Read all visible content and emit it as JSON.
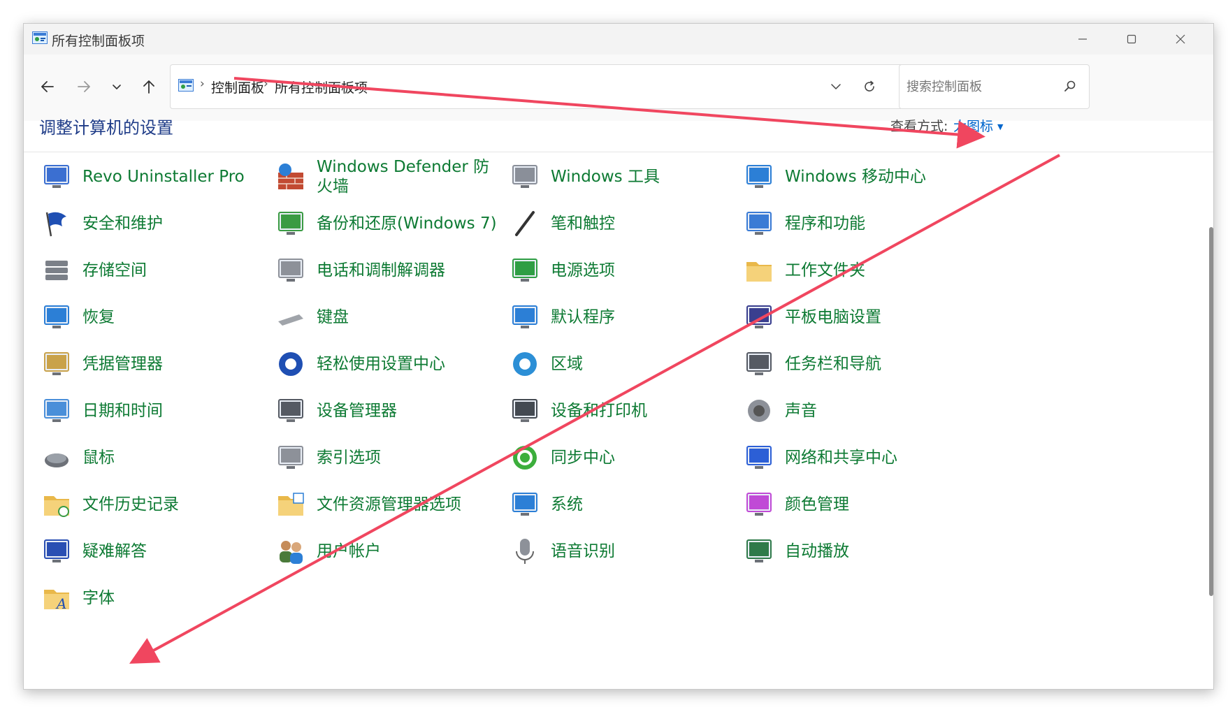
{
  "window": {
    "title": "所有控制面板项",
    "accent_color": "#1f3c88",
    "link_color": "#0d7a33",
    "controls": {
      "minimize": "minimize-icon",
      "maximize": "maximize-icon",
      "close": "close-icon"
    }
  },
  "nav": {
    "back": "back-arrow-icon",
    "forward": "forward-arrow-icon",
    "recent": "chevron-down-icon",
    "up": "up-arrow-icon"
  },
  "address": {
    "crumbs": [
      "控制面板",
      "所有控制面板项"
    ],
    "separator": "›",
    "dropdown": "chevron-down-icon",
    "refresh": "refresh-icon"
  },
  "search": {
    "placeholder": "搜索控制面板",
    "value": ""
  },
  "header": {
    "title": "调整计算机的设置",
    "view_label": "查看方式:",
    "view_value": "大图标"
  },
  "annotation_arrow_color": "#f0465f",
  "items": [
    {
      "label": "Revo Uninstaller Pro",
      "icon": "revo-uninstaller-icon"
    },
    {
      "label": "Windows Defender 防火墙",
      "icon": "firewall-icon"
    },
    {
      "label": "Windows 工具",
      "icon": "windows-tools-icon"
    },
    {
      "label": "Windows 移动中心",
      "icon": "mobility-center-icon"
    },
    {
      "label": "安全和维护",
      "icon": "security-flag-icon"
    },
    {
      "label": "备份和还原(Windows 7)",
      "icon": "backup-restore-icon"
    },
    {
      "label": "笔和触控",
      "icon": "pen-icon"
    },
    {
      "label": "程序和功能",
      "icon": "programs-icon"
    },
    {
      "label": "存储空间",
      "icon": "storage-icon"
    },
    {
      "label": "电话和调制解调器",
      "icon": "phone-modem-icon"
    },
    {
      "label": "电源选项",
      "icon": "power-options-icon"
    },
    {
      "label": "工作文件夹",
      "icon": "work-folders-icon"
    },
    {
      "label": "恢复",
      "icon": "recovery-icon"
    },
    {
      "label": "键盘",
      "icon": "keyboard-icon"
    },
    {
      "label": "默认程序",
      "icon": "default-programs-icon"
    },
    {
      "label": "平板电脑设置",
      "icon": "tablet-settings-icon"
    },
    {
      "label": "凭据管理器",
      "icon": "credential-manager-icon"
    },
    {
      "label": "轻松使用设置中心",
      "icon": "ease-of-access-icon"
    },
    {
      "label": "区域",
      "icon": "region-icon"
    },
    {
      "label": "任务栏和导航",
      "icon": "taskbar-icon"
    },
    {
      "label": "日期和时间",
      "icon": "date-time-icon"
    },
    {
      "label": "设备管理器",
      "icon": "device-manager-icon"
    },
    {
      "label": "设备和打印机",
      "icon": "devices-printers-icon"
    },
    {
      "label": "声音",
      "icon": "sound-icon"
    },
    {
      "label": "鼠标",
      "icon": "mouse-icon"
    },
    {
      "label": "索引选项",
      "icon": "indexing-icon"
    },
    {
      "label": "同步中心",
      "icon": "sync-center-icon"
    },
    {
      "label": "网络和共享中心",
      "icon": "network-sharing-icon"
    },
    {
      "label": "文件历史记录",
      "icon": "file-history-icon"
    },
    {
      "label": "文件资源管理器选项",
      "icon": "explorer-options-icon"
    },
    {
      "label": "系统",
      "icon": "system-icon"
    },
    {
      "label": "颜色管理",
      "icon": "color-management-icon"
    },
    {
      "label": "疑难解答",
      "icon": "troubleshooting-icon"
    },
    {
      "label": "用户帐户",
      "icon": "user-accounts-icon"
    },
    {
      "label": "语音识别",
      "icon": "speech-recognition-icon"
    },
    {
      "label": "自动播放",
      "icon": "autoplay-icon"
    },
    {
      "label": "字体",
      "icon": "fonts-icon"
    }
  ]
}
